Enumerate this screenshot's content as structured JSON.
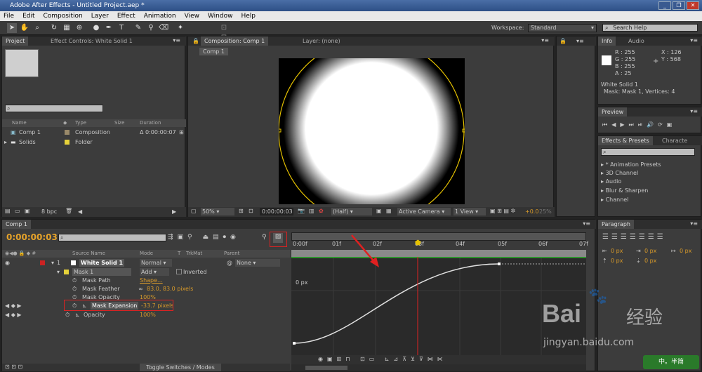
{
  "app": {
    "title": "Adobe After Effects - Untitled Project.aep *",
    "window_buttons": [
      "_",
      "❐",
      "✕"
    ]
  },
  "menu": [
    "File",
    "Edit",
    "Composition",
    "Layer",
    "Effect",
    "Animation",
    "View",
    "Window",
    "Help"
  ],
  "toolbar": {
    "workspace_label": "Workspace:",
    "workspace_value": "Standard",
    "search_help": "Search Help"
  },
  "project_panel": {
    "tab1": "Project",
    "tab2": "Effect Controls: White Solid 1",
    "columns": [
      "Name",
      "Type",
      "Size",
      "Duration"
    ],
    "items": [
      {
        "name": "Comp 1",
        "type": "Composition",
        "duration": "Δ 0:00:00:07"
      },
      {
        "name": "Solids",
        "type": "Folder",
        "duration": ""
      }
    ],
    "bpc": "8 bpc"
  },
  "composition_panel": {
    "tab1": "Composition: Comp 1",
    "tab2": "Layer: (none)",
    "subtab": "Comp 1",
    "zoom": "50%",
    "time": "0:00:00:03",
    "resolution": "(Half)",
    "camera": "Active Camera",
    "view": "1 View",
    "exposure": "+0.0",
    "quality": "25%"
  },
  "info_panel": {
    "tab1": "Info",
    "tab2": "Audio",
    "r": "R : 255",
    "g": "G : 255",
    "b": "B : 255",
    "a": "A : 25",
    "x": "X : 126",
    "y": "Y : 568",
    "plus": "+",
    "layer": "White Solid 1",
    "mask": "Mask: Mask 1, Vertices: 4"
  },
  "preview_panel": {
    "tab": "Preview"
  },
  "effects_panel": {
    "tab1": "Effects & Presets",
    "tab2": "Characte",
    "items": [
      "* Animation Presets",
      "3D Channel",
      "Audio",
      "Blur & Sharpen",
      "Channel"
    ]
  },
  "paragraph_panel": {
    "tab": "Paragraph",
    "values": [
      "0 px",
      "0 px",
      "0 px",
      "0 px",
      "0 px"
    ]
  },
  "timeline": {
    "tab": "Comp 1",
    "time": "0:00:00:03",
    "columns": {
      "source": "Source Name",
      "mode": "Mode",
      "t": "T",
      "trkmat": "TrkMat",
      "parent": "Parent"
    },
    "layer": {
      "num": "1",
      "name": "White Solid 1",
      "mode": "Normal",
      "parent": "None"
    },
    "mask": {
      "name": "Mask 1",
      "mode": "Add",
      "inverted": "Inverted"
    },
    "props": [
      {
        "name": "Mask Path",
        "value": "Shape..."
      },
      {
        "name": "Mask Feather",
        "value": "83.0, 83.0 pixels"
      },
      {
        "name": "Mask Opacity",
        "value": "100%"
      },
      {
        "name": "Mask Expansion",
        "value": "-33.7 pixels"
      },
      {
        "name": "Opacity",
        "value": "100%"
      }
    ],
    "ruler": [
      "0:00f",
      "01f",
      "02f",
      "03f",
      "04f",
      "05f",
      "06f",
      "07f"
    ],
    "graph_label": "0 px",
    "footer": "Toggle Switches / Modes"
  },
  "watermark": {
    "brand": "Bai",
    "brand2": "经验",
    "url": "jingyan.baidu.com",
    "corner": "中。半简"
  },
  "colors": {
    "accent_yellow": "#e6c200",
    "timecode": "#e6a32a",
    "red_box": "#d22222",
    "green_line": "#2ca82c"
  }
}
